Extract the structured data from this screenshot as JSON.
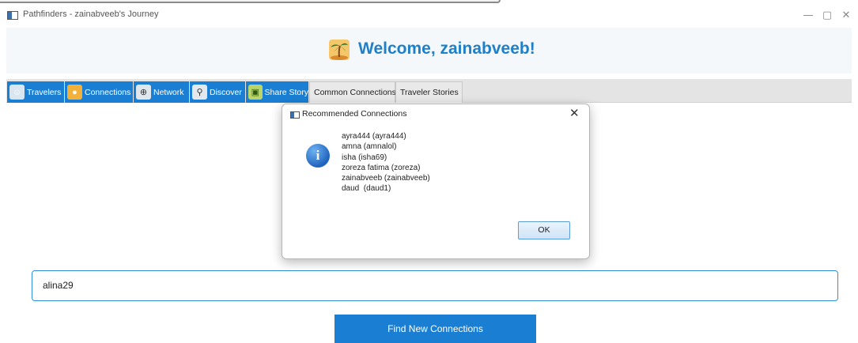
{
  "window": {
    "title": "Pathfinders - zainabveeb's Journey",
    "controls": {
      "minimize": "—",
      "restore": "▢",
      "close": "✕"
    }
  },
  "header": {
    "welcome": "Welcome, zainabveeb!",
    "logo_icon": "palm-tree-icon"
  },
  "tabs": [
    {
      "label": "Travelers",
      "icon": "traveler-icon",
      "selected": true
    },
    {
      "label": "Connections",
      "icon": "connections-icon",
      "selected": true
    },
    {
      "label": "Network",
      "icon": "network-icon",
      "selected": true
    },
    {
      "label": "Discover",
      "icon": "discover-icon",
      "selected": true
    },
    {
      "label": "Share Story",
      "icon": "share-story-icon",
      "selected": true
    },
    {
      "label": "Common Connections",
      "selected": false
    },
    {
      "label": "Traveler Stories",
      "selected": false
    }
  ],
  "search": {
    "value": "alina29"
  },
  "find_button": {
    "label": "Find New Connections"
  },
  "dialog": {
    "title": "Recommended Connections",
    "close": "✕",
    "info_glyph": "i",
    "lines": [
      "ayra444 (ayra444)",
      "amna (amnalol)",
      "isha (isha69)",
      "zoreza fatima (zoreza)",
      "zainabveeb (zainabveeb)",
      "daud  (daud1)"
    ],
    "ok_label": "OK"
  },
  "colors": {
    "accent": "#1a7fd3",
    "welcome_text": "#1f7fc7",
    "header_bg": "#f4f8fb"
  }
}
